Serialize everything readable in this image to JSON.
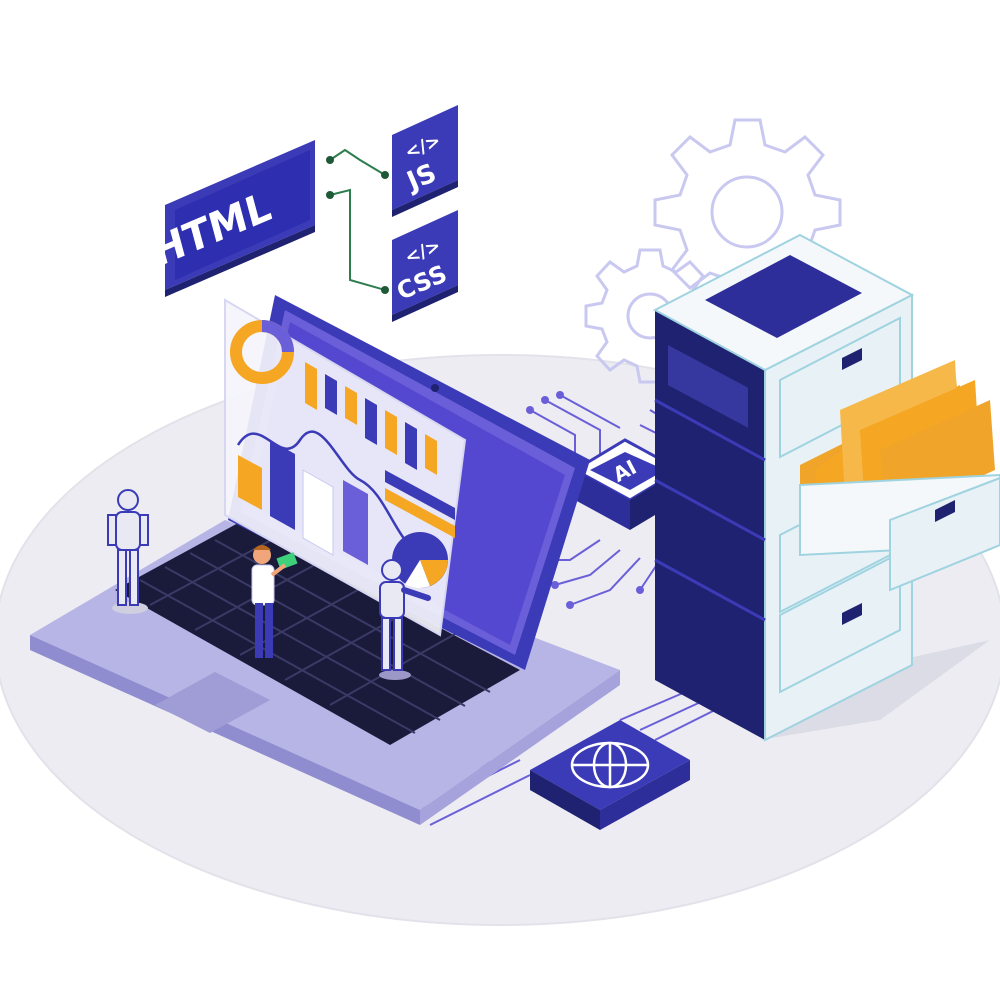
{
  "labels": {
    "html": "HTML",
    "js": "JS",
    "css": "CSS",
    "code_symbol": "</>",
    "ai_chip": "AI"
  },
  "colors": {
    "primary_blue": "#3b3bb8",
    "dark_navy": "#1f2270",
    "violet": "#6a5fd8",
    "orange": "#f5a623",
    "light_lavender": "#c9c8f0",
    "platform_gray": "#ececf2",
    "cabinet_white": "#eef4f8"
  },
  "icons": [
    "gear-icon",
    "globe-icon",
    "ai-chip-icon",
    "folder-icon",
    "robot-figure",
    "person-figure",
    "donut-chart-icon",
    "bar-chart-icon",
    "pie-chart-icon"
  ]
}
